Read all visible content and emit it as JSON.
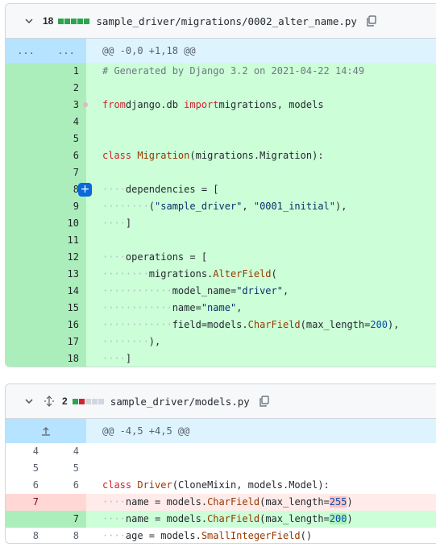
{
  "file1": {
    "count": "18",
    "bars": [
      "#2da44e",
      "#2da44e",
      "#2da44e",
      "#2da44e",
      "#2da44e"
    ],
    "path": "sample_driver/migrations/0002_alter_name.py",
    "hunk": {
      "left": "...",
      "right": "...",
      "text": "@@ -0,0 +1,18 @@"
    },
    "lines": [
      {
        "n": "1",
        "segs": [
          [
            "cm",
            "# Generated by Django 3.2 on 2021-04-22 14:49"
          ]
        ]
      },
      {
        "n": "2",
        "segs": []
      },
      {
        "n": "3",
        "segs": [
          [
            "kw",
            "from"
          ],
          [
            "",
            "django.db "
          ],
          [
            "kw",
            "import"
          ],
          [
            "",
            "migrations, models"
          ]
        ]
      },
      {
        "n": "4",
        "segs": []
      },
      {
        "n": "5",
        "segs": []
      },
      {
        "n": "6",
        "segs": [
          [
            "kw",
            "class"
          ],
          [
            "",
            " "
          ],
          [
            "cls",
            "Migration"
          ],
          [
            "",
            "(migrations.Migration):"
          ]
        ]
      },
      {
        "n": "7",
        "segs": []
      },
      {
        "n": "8",
        "segs": [
          [
            "ws",
            "····"
          ],
          [
            "",
            "dependencies = ["
          ]
        ]
      },
      {
        "n": "9",
        "segs": [
          [
            "ws",
            "········"
          ],
          [
            "",
            "("
          ],
          [
            "str",
            "\"sample_driver\""
          ],
          [
            "",
            ", "
          ],
          [
            "str",
            "\"0001_initial\""
          ],
          [
            "",
            "),"
          ]
        ]
      },
      {
        "n": "10",
        "segs": [
          [
            "ws",
            "····"
          ],
          [
            "",
            "]"
          ]
        ]
      },
      {
        "n": "11",
        "segs": []
      },
      {
        "n": "12",
        "segs": [
          [
            "ws",
            "····"
          ],
          [
            "",
            "operations = ["
          ]
        ]
      },
      {
        "n": "13",
        "segs": [
          [
            "ws",
            "········"
          ],
          [
            "",
            "migrations."
          ],
          [
            "cls",
            "AlterField"
          ],
          [
            "",
            "("
          ]
        ]
      },
      {
        "n": "14",
        "segs": [
          [
            "ws",
            "············"
          ],
          [
            "",
            "model_name="
          ],
          [
            "str",
            "\"driver\""
          ],
          [
            "",
            ","
          ]
        ]
      },
      {
        "n": "15",
        "segs": [
          [
            "ws",
            "············"
          ],
          [
            "",
            "name="
          ],
          [
            "str",
            "\"name\""
          ],
          [
            "",
            ","
          ]
        ]
      },
      {
        "n": "16",
        "segs": [
          [
            "ws",
            "············"
          ],
          [
            "",
            "field=models."
          ],
          [
            "cls",
            "CharField"
          ],
          [
            "",
            "(max_length="
          ],
          [
            "num",
            "200"
          ],
          [
            "",
            "),"
          ]
        ]
      },
      {
        "n": "17",
        "segs": [
          [
            "ws",
            "········"
          ],
          [
            "",
            "),"
          ]
        ]
      },
      {
        "n": "18",
        "segs": [
          [
            "ws",
            "····"
          ],
          [
            "",
            "]"
          ]
        ]
      }
    ]
  },
  "file2": {
    "count": "2",
    "bars": [
      "#2da44e",
      "#cf222e",
      "#d0d7de",
      "#d0d7de",
      "#d0d7de"
    ],
    "path": "sample_driver/models.py",
    "hunk": {
      "text": "@@ -4,5 +4,5 @@"
    },
    "lines": [
      {
        "type": "ctx",
        "a": "4",
        "b": "4",
        "segs": []
      },
      {
        "type": "ctx",
        "a": "5",
        "b": "5",
        "segs": []
      },
      {
        "type": "ctx",
        "a": "6",
        "b": "6",
        "segs": [
          [
            "kw",
            "class"
          ],
          [
            "",
            " "
          ],
          [
            "cls",
            "Driver"
          ],
          [
            "",
            "(CloneMixin, models.Model):"
          ]
        ]
      },
      {
        "type": "del",
        "a": "7",
        "b": "",
        "segs": [
          [
            "ws",
            "····"
          ],
          [
            "",
            "name = models."
          ],
          [
            "cls",
            "CharField"
          ],
          [
            "",
            "(max_length="
          ],
          [
            "hl-del num",
            "255"
          ],
          [
            "",
            ")"
          ]
        ]
      },
      {
        "type": "add",
        "a": "",
        "b": "7",
        "segs": [
          [
            "ws",
            "····"
          ],
          [
            "",
            "name = models."
          ],
          [
            "cls",
            "CharField"
          ],
          [
            "",
            "(max_length="
          ],
          [
            "hl-add num",
            "200"
          ],
          [
            "",
            ")"
          ]
        ]
      },
      {
        "type": "ctx",
        "a": "8",
        "b": "8",
        "segs": [
          [
            "ws",
            "····"
          ],
          [
            "",
            "age = models."
          ],
          [
            "cls",
            "SmallIntegerField"
          ],
          [
            "",
            "()"
          ]
        ]
      }
    ]
  },
  "icons": {
    "chevron": "chevron-down-icon",
    "copy": "copy-icon",
    "expand": "expand-icon",
    "add": "add-comment-icon"
  }
}
